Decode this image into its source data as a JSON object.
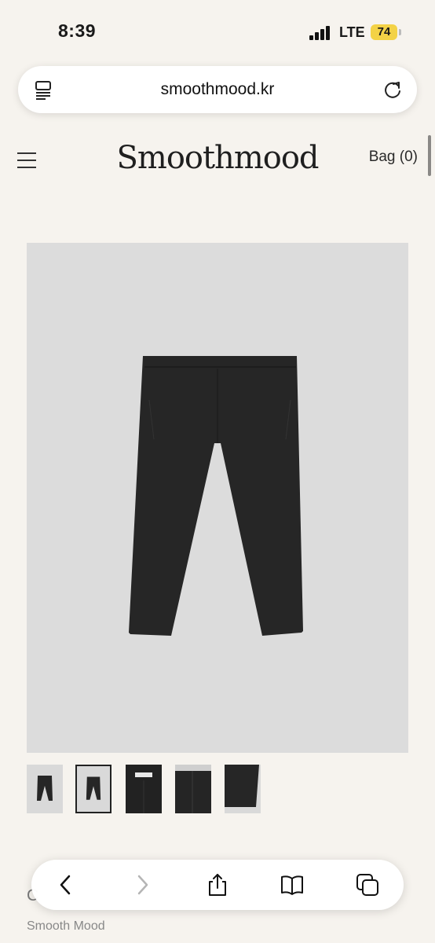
{
  "status_bar": {
    "time": "8:39",
    "network": "LTE",
    "battery": "74"
  },
  "browser": {
    "url": "smoothmood.kr"
  },
  "site": {
    "logo": "Smoothmood",
    "bag_label": "Bag (0)"
  },
  "product": {
    "name": "C",
    "brand": "Smooth Mood",
    "thumbnail_count": 5,
    "active_thumbnail": 2
  },
  "toolbar": {
    "buttons": [
      "back",
      "forward",
      "share",
      "bookmarks",
      "tabs"
    ]
  },
  "colors": {
    "background": "#f6f3ee",
    "battery": "#f3d246",
    "image_bg": "#dcdcdc",
    "garment": "#262626"
  }
}
